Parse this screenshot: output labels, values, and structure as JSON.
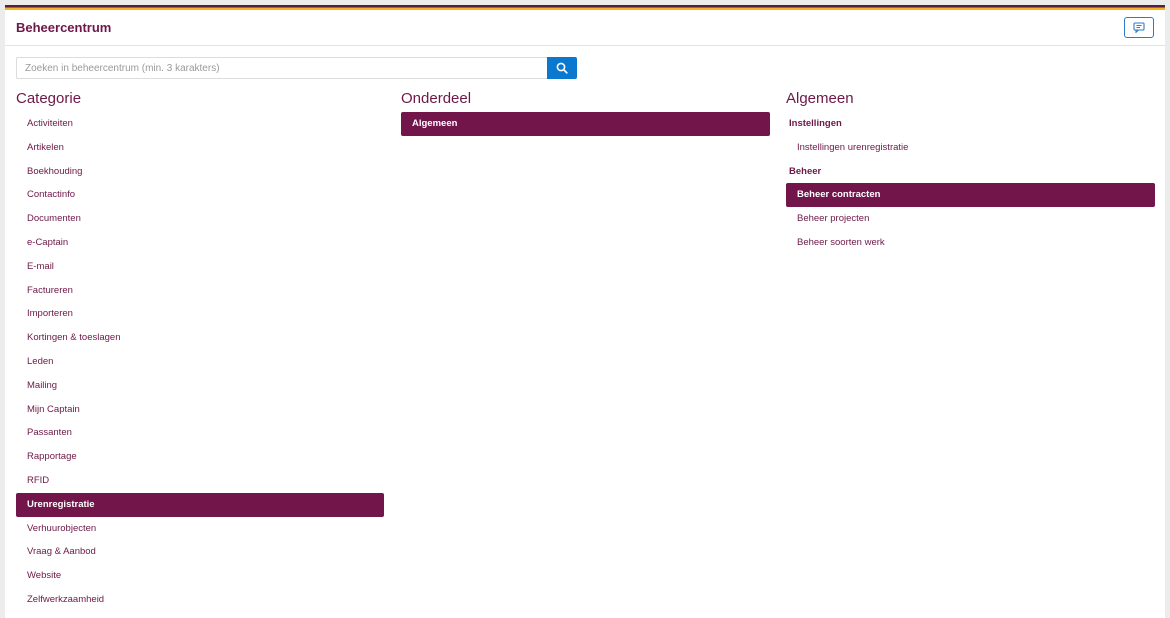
{
  "header": {
    "title": "Beheercentrum"
  },
  "search": {
    "placeholder": "Zoeken in beheercentrum (min. 3 karakters)",
    "value": ""
  },
  "categorie": {
    "title": "Categorie",
    "items": [
      {
        "label": "Activiteiten"
      },
      {
        "label": "Artikelen"
      },
      {
        "label": "Boekhouding"
      },
      {
        "label": "Contactinfo"
      },
      {
        "label": "Documenten"
      },
      {
        "label": "e-Captain"
      },
      {
        "label": "E-mail"
      },
      {
        "label": "Factureren"
      },
      {
        "label": "Importeren"
      },
      {
        "label": "Kortingen & toeslagen"
      },
      {
        "label": "Leden"
      },
      {
        "label": "Mailing"
      },
      {
        "label": "Mijn Captain"
      },
      {
        "label": "Passanten"
      },
      {
        "label": "Rapportage"
      },
      {
        "label": "RFID"
      },
      {
        "label": "Urenregistratie",
        "active": true
      },
      {
        "label": "Verhuurobjecten"
      },
      {
        "label": "Vraag & Aanbod"
      },
      {
        "label": "Website"
      },
      {
        "label": "Zelfwerkzaamheid"
      }
    ]
  },
  "onderdeel": {
    "title": "Onderdeel",
    "items": [
      {
        "label": "Algemeen",
        "active": true
      }
    ]
  },
  "algemeen": {
    "title": "Algemeen",
    "groups": [
      {
        "heading": "Instellingen",
        "items": [
          {
            "label": "Instellingen urenregistratie"
          }
        ]
      },
      {
        "heading": "Beheer",
        "items": [
          {
            "label": "Beheer contracten",
            "active": true
          },
          {
            "label": "Beheer projecten"
          },
          {
            "label": "Beheer soorten werk"
          }
        ]
      }
    ]
  },
  "colors": {
    "brand": "#71154a",
    "accent": "#0b78d0"
  },
  "icons": {
    "chat": "chat-icon",
    "search": "search-icon"
  }
}
